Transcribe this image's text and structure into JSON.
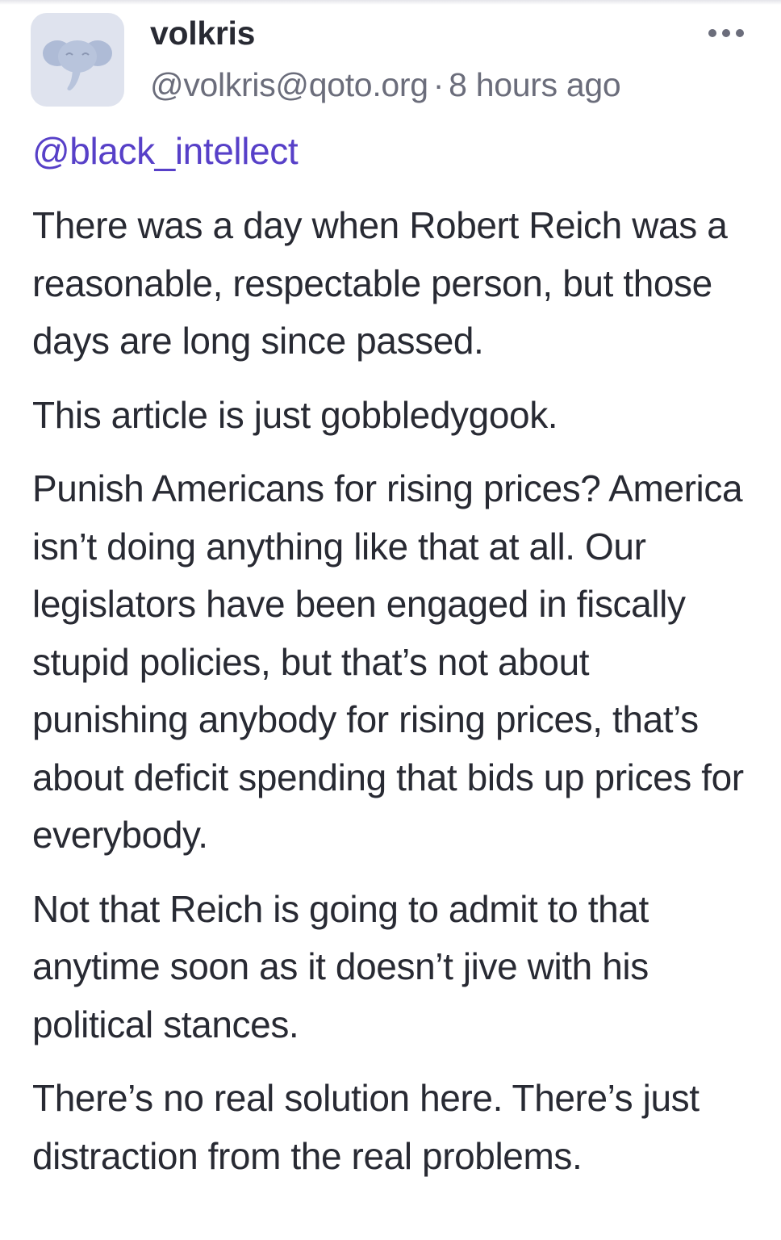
{
  "post": {
    "display_name": "volkris",
    "handle": "@volkris@qoto.org",
    "separator": "·",
    "time_ago": "8 hours ago",
    "mention": "@black_intellect",
    "avatar_icon": "elephant-avatar-icon",
    "more_icon": "more-horizontal-icon",
    "paragraphs": [
      "There was a day when Robert Reich was a reasonable, respectable person, but those days are long since passed.",
      "This article is just gobbledygook.",
      "Punish Americans for rising prices? America isn’t doing anything like that at all. Our legislators have been engaged in fiscally stupid policies, but that’s not about punishing anybody for rising prices, that’s about deficit spending that bids up prices for everybody.",
      "Not that Reich is going to admit to that anytime soon as it doesn’t jive with his political stances.",
      "There’s no real solution here. There’s just distraction from the real problems."
    ]
  },
  "colors": {
    "text": "#282a33",
    "muted": "#6b6d7b",
    "mention": "#5740c8",
    "avatar_bg": "#dfe3ee",
    "avatar_elephant": "#aebbd6"
  }
}
